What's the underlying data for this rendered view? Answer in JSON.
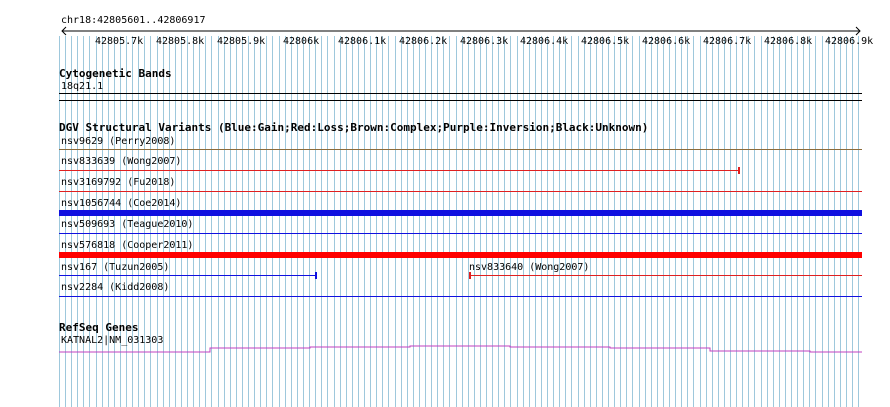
{
  "locus": {
    "label": "chr18:42805601..42806917",
    "ticks": [
      "42805.7k",
      "42805.8k",
      "42805.9k",
      "42806k",
      "42806.1k",
      "42806.2k",
      "42806.3k",
      "42806.4k",
      "42806.5k",
      "42806.6k",
      "42806.7k",
      "42806.8k",
      "42806.9k"
    ]
  },
  "cytoband": {
    "title": "Cytogenetic Bands",
    "band": "18q21.1"
  },
  "dgv": {
    "title": "DGV Structural Variants (Blue:Gain;Red:Loss;Brown:Complex;Purple:Inversion;Black:Unknown)",
    "variants": [
      {
        "label": "nsv9629 (Perry2008)",
        "type": "complex",
        "color": "#8b4513"
      },
      {
        "label": "nsv833639 (Wong2007)",
        "type": "loss",
        "color": "#e02020"
      },
      {
        "label": "nsv3169792 (Fu2018)",
        "type": "loss",
        "color": "#e02020"
      },
      {
        "label": "nsv1056744 (Coe2014)",
        "type": "gain",
        "color": "#1010e0"
      },
      {
        "label": "nsv509693 (Teague2010)",
        "type": "gain",
        "color": "#1010e0"
      },
      {
        "label": "nsv576818 (Cooper2011)",
        "type": "loss",
        "color": "#ff0000"
      },
      {
        "label": "nsv167 (Tuzun2005)",
        "type": "gain",
        "color": "#1010e0"
      },
      {
        "label": "nsv833640 (Wong2007)",
        "type": "loss",
        "color": "#e02020"
      },
      {
        "label": "nsv2284 (Kidd2008)",
        "type": "gain",
        "color": "#1010e0"
      }
    ]
  },
  "refseq": {
    "title": "RefSeq Genes",
    "gene": "KATNAL2|NM_031303",
    "color": "#c040c0"
  },
  "colors": {
    "grid": "#9ec8dc",
    "axis": "#000000"
  }
}
